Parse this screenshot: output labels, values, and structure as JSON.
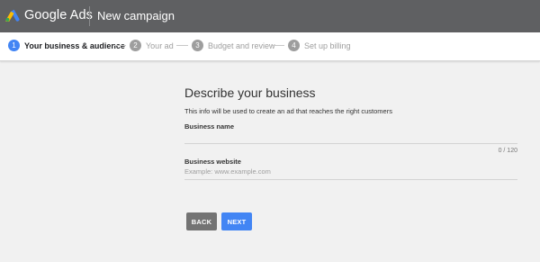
{
  "header": {
    "brand": "Google Ads",
    "page_title": "New campaign",
    "logo_colors": [
      "#fbbc04",
      "#4285f4",
      "#34a853"
    ]
  },
  "stepper": {
    "steps": [
      {
        "number": "1",
        "label": "Your business & audience",
        "state": "active"
      },
      {
        "number": "2",
        "label": "Your ad",
        "state": "inactive"
      },
      {
        "number": "3",
        "label": "Budget and review",
        "state": "inactive"
      },
      {
        "number": "4",
        "label": "Set up billing",
        "state": "inactive"
      }
    ],
    "active_color": "#4285f4"
  },
  "form": {
    "heading": "Describe your business",
    "description": "This info will be used to create an ad that reaches the right customers",
    "business_name": {
      "label": "Business name",
      "value": "",
      "counter": "0 / 120"
    },
    "business_website": {
      "label": "Business website",
      "placeholder": "Example: www.example.com",
      "value": ""
    }
  },
  "actions": {
    "back_label": "BACK",
    "next_label": "NEXT"
  }
}
